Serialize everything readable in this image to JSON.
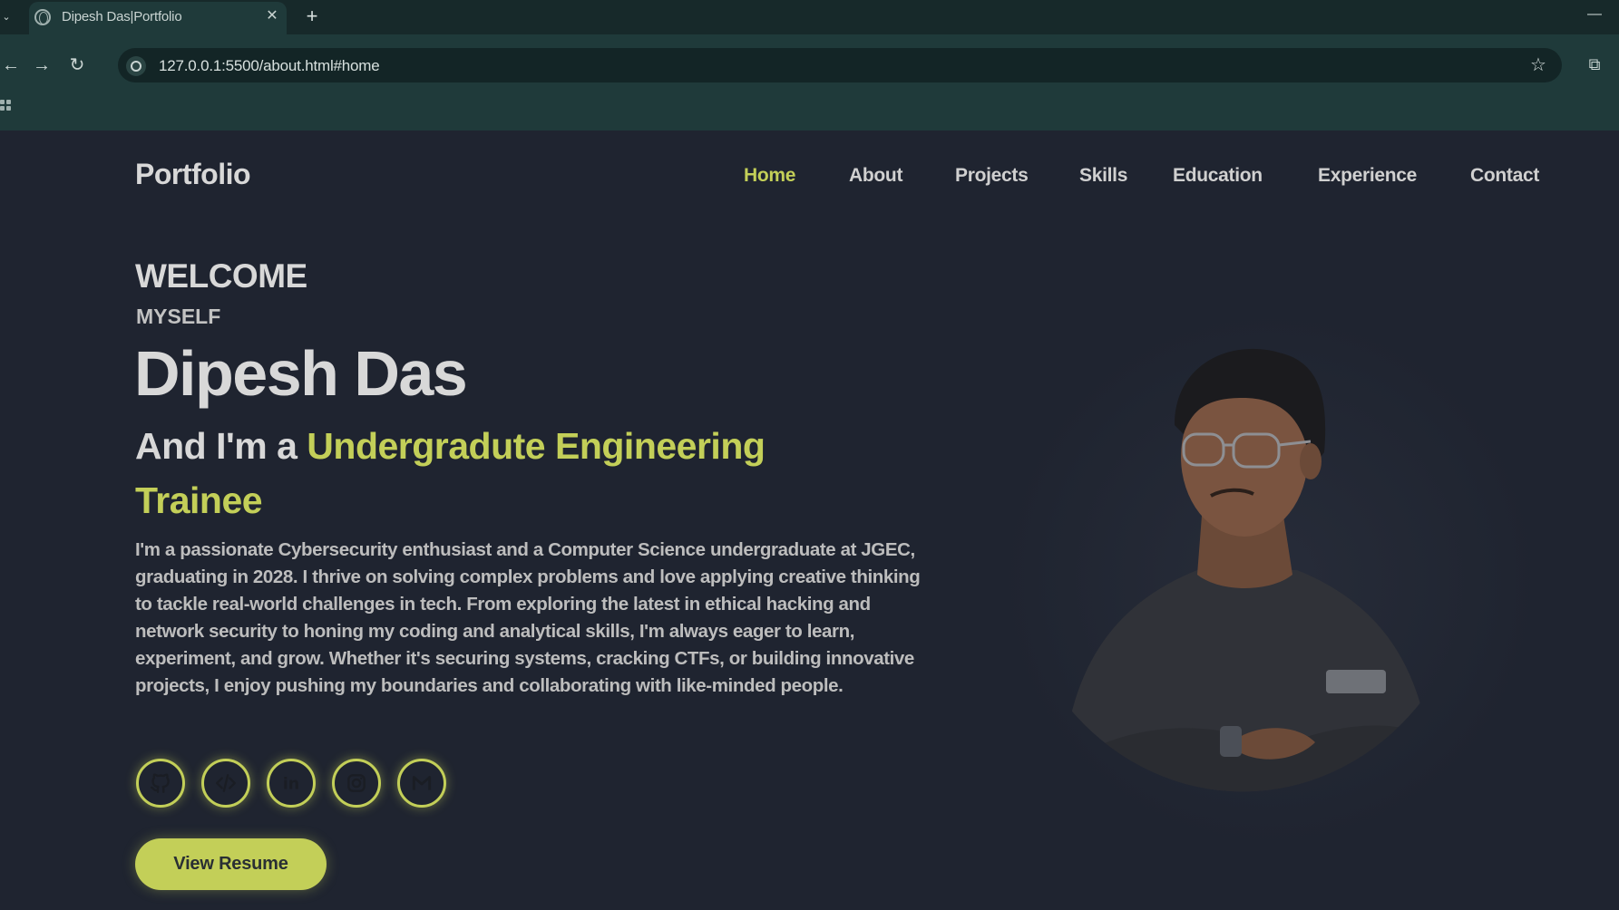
{
  "browser": {
    "tab_title": "Dipesh Das|Portfolio",
    "url": "127.0.0.1:5500/about.html#home"
  },
  "site": {
    "logo": "Portfolio",
    "nav": [
      {
        "label": "Home",
        "active": true
      },
      {
        "label": "About"
      },
      {
        "label": "Projects"
      },
      {
        "label": "Skills"
      },
      {
        "label": "Education"
      },
      {
        "label": "Experience"
      },
      {
        "label": "Contact"
      }
    ]
  },
  "hero": {
    "welcome": "WELCOME",
    "myself": "MYSELF",
    "name": "Dipesh Das",
    "role_prefix": "And I'm a",
    "role_accent": "Undergradute Engineering Trainee",
    "bio": "I'm a passionate Cybersecurity enthusiast and a Computer Science undergraduate at JGEC, graduating in 2028. I thrive on solving complex problems and love applying creative thinking to tackle real-world challenges in tech. From exploring the latest in ethical hacking and network security to honing my coding and analytical skills, I'm always eager to learn, experiment, and grow. Whether it's securing systems, cracking CTFs, or building innovative projects, I enjoy pushing my boundaries and collaborating with like-minded people.",
    "socials": [
      "github-icon",
      "code-icon",
      "linkedin-icon",
      "instagram-icon",
      "gmail-icon"
    ],
    "resume_button": "View Resume"
  },
  "colors": {
    "accent": "#c3cf58",
    "background": "#1f2430",
    "browser_chrome": "#1f3a3a"
  }
}
